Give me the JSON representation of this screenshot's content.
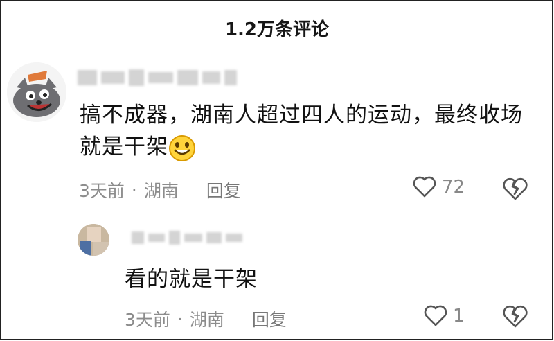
{
  "header": {
    "title": "1.2万条评论"
  },
  "comments": [
    {
      "text": "搞不成器，湖南人超过四人的运动，最终收场就是干架",
      "emoji": "grinning-face-emoji",
      "time": "3天前",
      "location": "湖南",
      "reply_label": "回复",
      "likes": "72"
    },
    {
      "text": "看的就是干架",
      "time": "3天前",
      "location": "湖南",
      "reply_label": "回复",
      "likes": "1"
    }
  ],
  "icons": {
    "like": "heart-outline-icon",
    "dislike": "broken-heart-icon"
  },
  "colors": {
    "text": "#111111",
    "meta": "#8c8c8c",
    "icon": "#555555"
  }
}
